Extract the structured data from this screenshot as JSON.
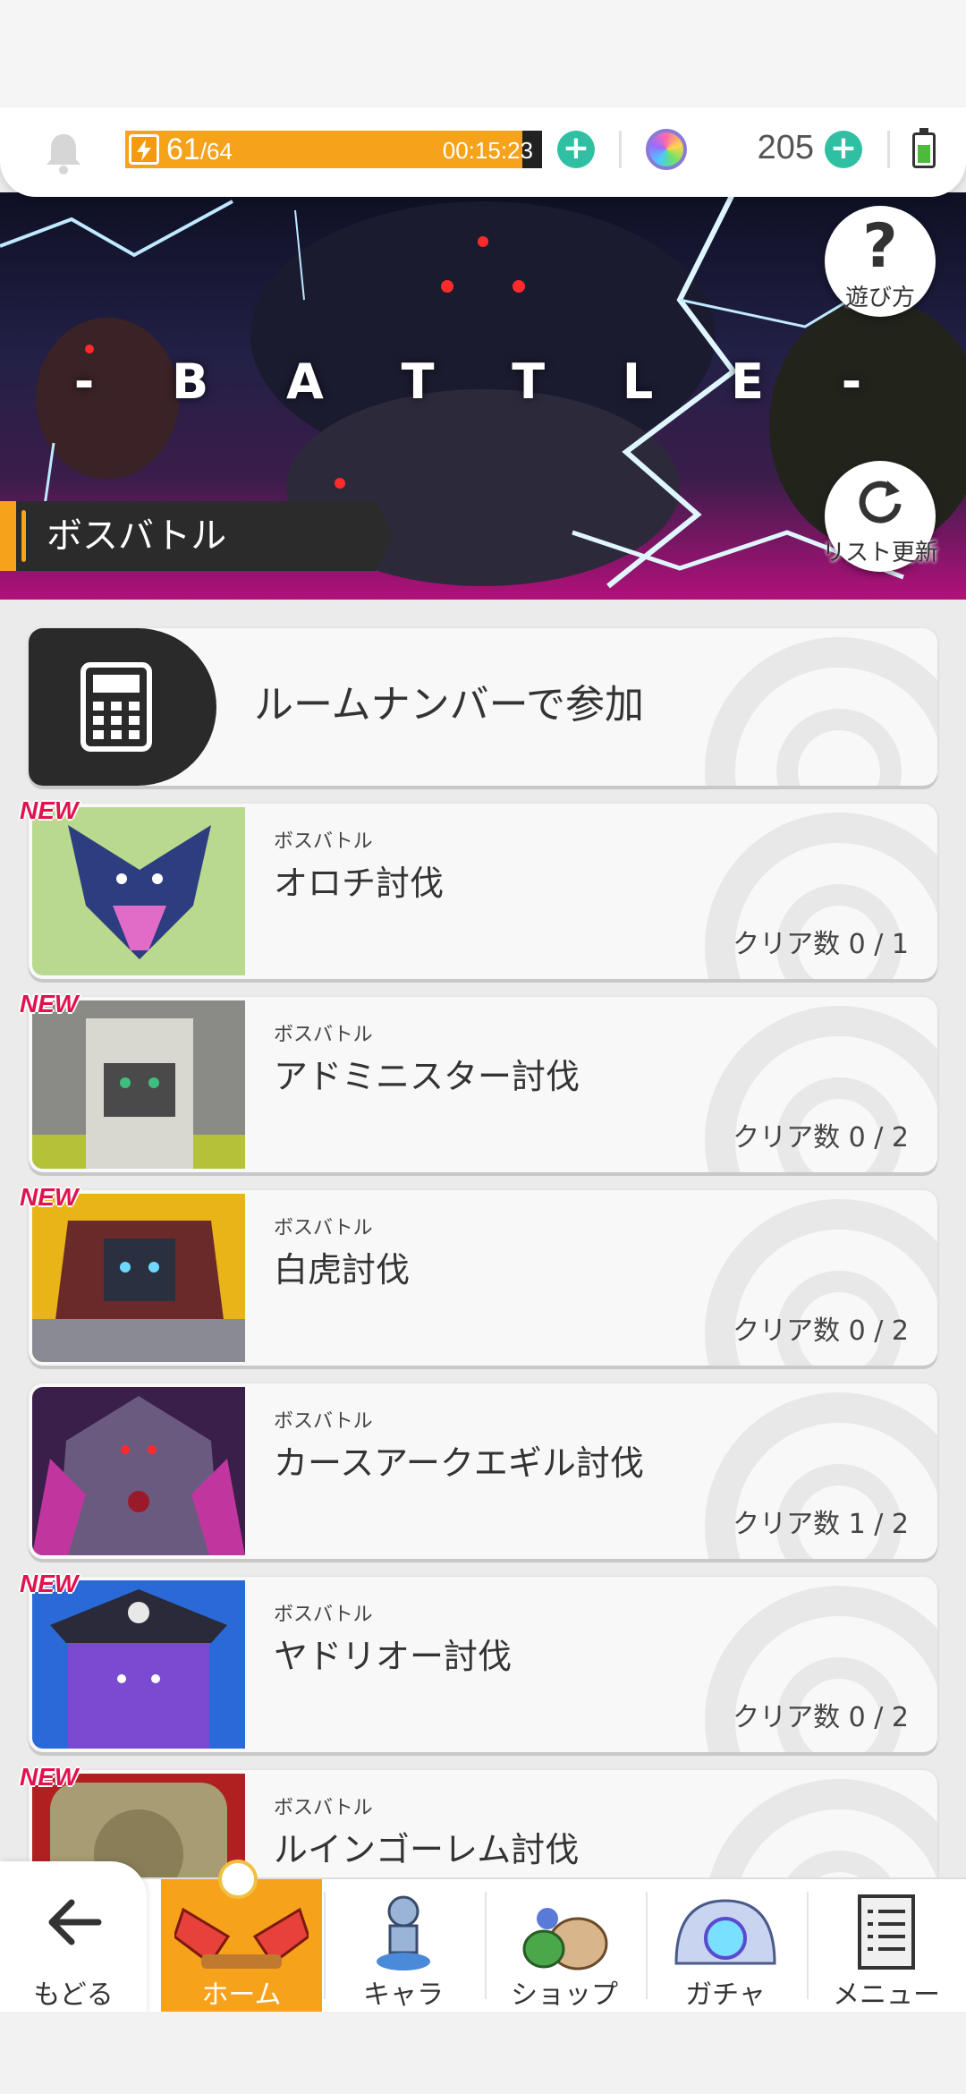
{
  "status": {
    "stamina_current": "61",
    "stamina_max": "/64",
    "stamina_fraction": 0.953,
    "timer": "00:15:23",
    "gems": "205",
    "accent_color": "#f7a21b",
    "plus_color": "#2fc0a3"
  },
  "banner": {
    "title": "- B A T T L E -",
    "help_label": "遊び方",
    "refresh_label": "リスト更新",
    "section_label": "ボスバトル"
  },
  "room": {
    "label": "ルームナンバーで参加",
    "icon": "calculator-icon"
  },
  "bosses": [
    {
      "new": "NEW",
      "sub": "ボスバトル",
      "name": "オロチ討伐",
      "clear": "クリア数 0 / 1"
    },
    {
      "new": "NEW",
      "sub": "ボスバトル",
      "name": "アドミニスター討伐",
      "clear": "クリア数 0 / 2"
    },
    {
      "new": "NEW",
      "sub": "ボスバトル",
      "name": "白虎討伐",
      "clear": "クリア数 0 / 2"
    },
    {
      "new": "",
      "sub": "ボスバトル",
      "name": "カースアークエギル討伐",
      "clear": "クリア数 1 / 2"
    },
    {
      "new": "NEW",
      "sub": "ボスバトル",
      "name": "ヤドリオー討伐",
      "clear": "クリア数 0 / 2"
    },
    {
      "new": "NEW",
      "sub": "ボスバトル",
      "name": "ルインゴーレム討伐",
      "clear": ""
    }
  ],
  "nav": {
    "back": "もどる",
    "home": "ホーム",
    "chara": "キャラ",
    "shop": "ショップ",
    "gacha": "ガチャ",
    "menu": "メニュー"
  }
}
